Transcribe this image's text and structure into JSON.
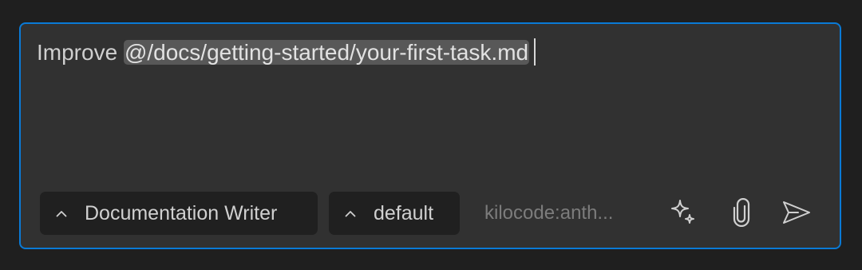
{
  "input": {
    "prefix": "Improve ",
    "mention": "@/docs/getting-started/your-first-task.md"
  },
  "toolbar": {
    "mode_label": "Documentation Writer",
    "profile_label": "default",
    "model_label": "kilocode:anth...",
    "icons": [
      "chevron-up-icon",
      "sparkles-icon",
      "paperclip-icon",
      "send-icon"
    ]
  },
  "colors": {
    "accent_border": "#0a7ad6",
    "panel_bg": "#313131",
    "dropdown_bg": "#202020",
    "mention_bg": "#585858"
  }
}
